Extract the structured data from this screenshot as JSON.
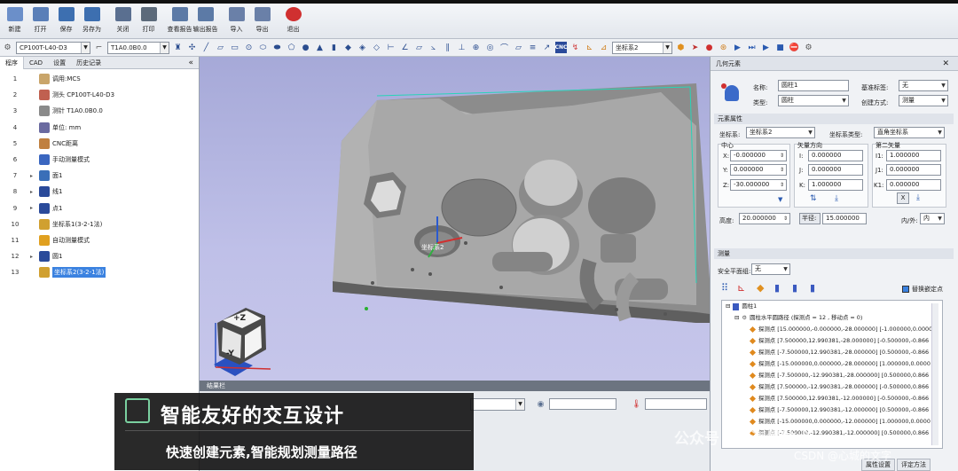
{
  "main_toolbar": [
    {
      "label": "新建",
      "icon": "new-file-icon",
      "color": "#6b8fc9"
    },
    {
      "label": "打开",
      "icon": "open-folder-icon",
      "color": "#5a7fb8"
    },
    {
      "label": "保存",
      "icon": "save-icon",
      "color": "#3d6fb0"
    },
    {
      "label": "另存为",
      "icon": "save-as-icon",
      "color": "#3d6fb0"
    },
    {
      "label": "关闭",
      "icon": "close-file-icon",
      "color": "#5a6f90"
    },
    {
      "label": "打印",
      "icon": "print-icon",
      "color": "#5c6a7a"
    },
    {
      "label": "查看报告",
      "icon": "view-report-icon",
      "color": "#5c7aa6"
    },
    {
      "label": "输出报告",
      "icon": "export-report-icon",
      "color": "#5c7aa6"
    },
    {
      "label": "导入",
      "icon": "import-icon",
      "color": "#6a80a8"
    },
    {
      "label": "导出",
      "icon": "export-icon",
      "color": "#6a80a8"
    },
    {
      "label": "退出",
      "icon": "exit-icon",
      "color": "#d03030"
    }
  ],
  "toolbar2": {
    "probe_combo": "CP100T-L40-D3",
    "tip_combo": "T1A0.0B0.0",
    "coord_combo": "坐标系2",
    "cnc_label": "CNC"
  },
  "left_panel": {
    "tabs": [
      "程序",
      "CAD",
      "设置",
      "历史记录"
    ],
    "collapse_icon": "«",
    "rows": [
      {
        "num": "1",
        "label": "调用:MCS",
        "icon": "coordinate-icon",
        "color": "#c9a56a",
        "expand": ""
      },
      {
        "num": "2",
        "label": "测头 CP100T-L40-D3",
        "icon": "probe-icon",
        "color": "#c06050",
        "expand": ""
      },
      {
        "num": "3",
        "label": "测针 T1A0.0B0.0",
        "icon": "stylus-icon",
        "color": "#8a8a8a",
        "expand": ""
      },
      {
        "num": "4",
        "label": "单位: mm",
        "icon": "unit-icon",
        "color": "#6a6aa0",
        "expand": ""
      },
      {
        "num": "5",
        "label": "CNC距离",
        "icon": "cnc-distance-icon",
        "color": "#c08040",
        "expand": ""
      },
      {
        "num": "6",
        "label": "手动测量模式",
        "icon": "hand-icon",
        "color": "#3a66c0",
        "expand": ""
      },
      {
        "num": "7",
        "label": "面1",
        "icon": "plane-icon",
        "color": "#3a6fb8",
        "expand": "▸"
      },
      {
        "num": "8",
        "label": "线1",
        "icon": "line-icon",
        "color": "#2a4a9a",
        "expand": "▸"
      },
      {
        "num": "9",
        "label": "点1",
        "icon": "point-icon",
        "color": "#2a4a9a",
        "expand": "▸"
      },
      {
        "num": "10",
        "label": "坐标系1(3-2-1法)",
        "icon": "axis-icon",
        "color": "#d0a030",
        "expand": ""
      },
      {
        "num": "11",
        "label": "自动测量模式",
        "icon": "cnc-auto-icon",
        "color": "#e0a020",
        "expand": ""
      },
      {
        "num": "12",
        "label": "圆1",
        "icon": "circle-icon",
        "color": "#2a4a9a",
        "expand": "▸"
      },
      {
        "num": "13",
        "label": "坐标系2(3-2-1法)",
        "icon": "axis-icon",
        "color": "#d0a030",
        "expand": ""
      }
    ],
    "selected_row": "13"
  },
  "viewport": {
    "view_cube": {
      "top": "+Z",
      "front": "-Y"
    },
    "feature_label": "坐标系2"
  },
  "result_bar": {
    "label": "结果栏"
  },
  "right_panel": {
    "title": "几何元素",
    "close": "✕",
    "name_label": "名称:",
    "name_value": "圆柱1",
    "type_label": "类型:",
    "type_value": "圆柱",
    "datum_label": "基准标签:",
    "datum_value": "无",
    "create_label": "创建方式:",
    "create_value": "测量",
    "props_title": "元素属性",
    "coord_label": "坐标系:",
    "coord_value": "坐标系2",
    "coordtype_label": "坐标系类型:",
    "coordtype_value": "直角坐标系",
    "center_title": "中心",
    "x_label": "X:",
    "x_value": "-0.000000",
    "y_label": "Y:",
    "y_value": "0.000000",
    "z_label": "Z:",
    "z_value": "-30.000000",
    "vector_title": "矢量方向",
    "i_label": "I:",
    "i_value": "0.000000",
    "j_label": "J:",
    "j_value": "0.000000",
    "k_label": "K:",
    "k_value": "1.000000",
    "vector2_title": "第二矢量",
    "i1_label": "I1:",
    "i1_value": "1.000000",
    "j1_label": "J1:",
    "j1_value": "0.000000",
    "k1_label": "K1:",
    "k1_value": "0.000000",
    "x_btn": "X",
    "height_label": "高度:",
    "height_value": "20.000000",
    "radius_btn": "半径:",
    "radius_value": "15.000000",
    "inout_label": "内/外:",
    "inout_value": "内",
    "measure_title": "测量",
    "safe_label": "安全平面组:",
    "safe_value": "无",
    "replace_label": "替换嵌定点",
    "tree_root": "圆柱1",
    "tree_path": "圆柱水平圆路径 (探测点 = 12 , 移动点 = 0)",
    "points": [
      "探测点 [15.000000,-0.000000,-28.000000]   [-1.000000,0.0000",
      "探测点 [7.500000,12.990381,-28.000000]   [-0.500000,-0.866",
      "探测点 [-7.500000,12.990381,-28.000000]   [0.500000,-0.866",
      "探测点 [-15.000000,0.000000,-28.000000]   [1.000000,0.0000",
      "探测点 [-7.500000,-12.990381,-28.000000]   [0.500000,0.866",
      "探测点 [7.500000,-12.990381,-28.000000]   [-0.500000,0.866",
      "探测点 [7.500000,12.990381,-12.000000]   [-0.500000,-0.866",
      "探测点 [-7.500000,12.990381,-12.000000]   [0.500000,-0.866",
      "探测点 [-15.000000,0.000000,-12.000000]   [1.000000,0.0000",
      "探测点 [-7.500000,-12.990381,-12.000000]   [0.500000,0.866"
    ],
    "bottom_tabs": [
      "属性设置",
      "评定方法"
    ]
  },
  "banner": {
    "title": "智能友好的交互设计",
    "subtitle": "快速创建元素,智能规划测量路径"
  },
  "watermark": {
    "wechat": "公众号 · 微测量技术",
    "csdn": "CSDN @心城的文字"
  }
}
